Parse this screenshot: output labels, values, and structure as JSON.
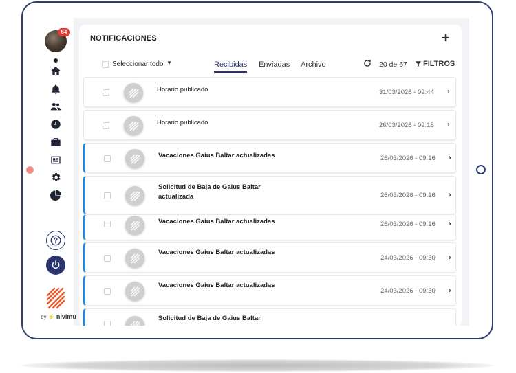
{
  "sidebar": {
    "badge": "64",
    "items": [
      {
        "icon": "home-icon"
      },
      {
        "icon": "bell-icon"
      },
      {
        "icon": "people-icon"
      },
      {
        "icon": "clock-icon"
      },
      {
        "icon": "briefcase-icon"
      },
      {
        "icon": "id-card-icon"
      },
      {
        "icon": "gear-icon"
      },
      {
        "icon": "pie-chart-icon"
      }
    ],
    "help_icon": "question-icon",
    "power_icon": "power-icon",
    "by_text": "by",
    "brand": "nivimu"
  },
  "header": {
    "title": "NOTIFICACIONES",
    "add_icon": "plus-icon"
  },
  "toolbar": {
    "select_all": "Seleccionar todo",
    "tabs": [
      {
        "label": "Recibidas",
        "active": true
      },
      {
        "label": "Enviadas",
        "active": false
      },
      {
        "label": "Archivo",
        "active": false
      }
    ],
    "count": "20 de 67",
    "filters": "FILTROS"
  },
  "notifications": [
    {
      "text": "Horario publicado",
      "date": "31/03/2026 - 09:44",
      "unread": false
    },
    {
      "text": "Horario publicado",
      "date": "26/03/2026 - 09:18",
      "unread": false
    },
    {
      "text": "Vacaciones Gaius Baltar actualizadas",
      "date": "26/03/2026 - 09:16",
      "unread": true
    },
    {
      "text": "Solicitud de Baja de Gaius Baltar actualizada",
      "date": "26/03/2026 - 09:16",
      "unread": true
    },
    {
      "text": "Vacaciones Gaius Baltar actualizadas",
      "date": "26/03/2026 - 09:16",
      "unread": true
    },
    {
      "text": "Vacaciones Gaius Baltar actualizadas",
      "date": "24/03/2026 - 09:30",
      "unread": true
    },
    {
      "text": "Vacaciones Gaius Baltar actualizadas",
      "date": "24/03/2026 - 09:30",
      "unread": true
    },
    {
      "text": "Solicitud de Baja de Gaius Baltar",
      "date": "",
      "unread": true
    }
  ],
  "colors": {
    "accent": "#2a3570",
    "unread_bar": "#1e88e5",
    "badge": "#e53935",
    "frame": "#2f3e6e"
  }
}
